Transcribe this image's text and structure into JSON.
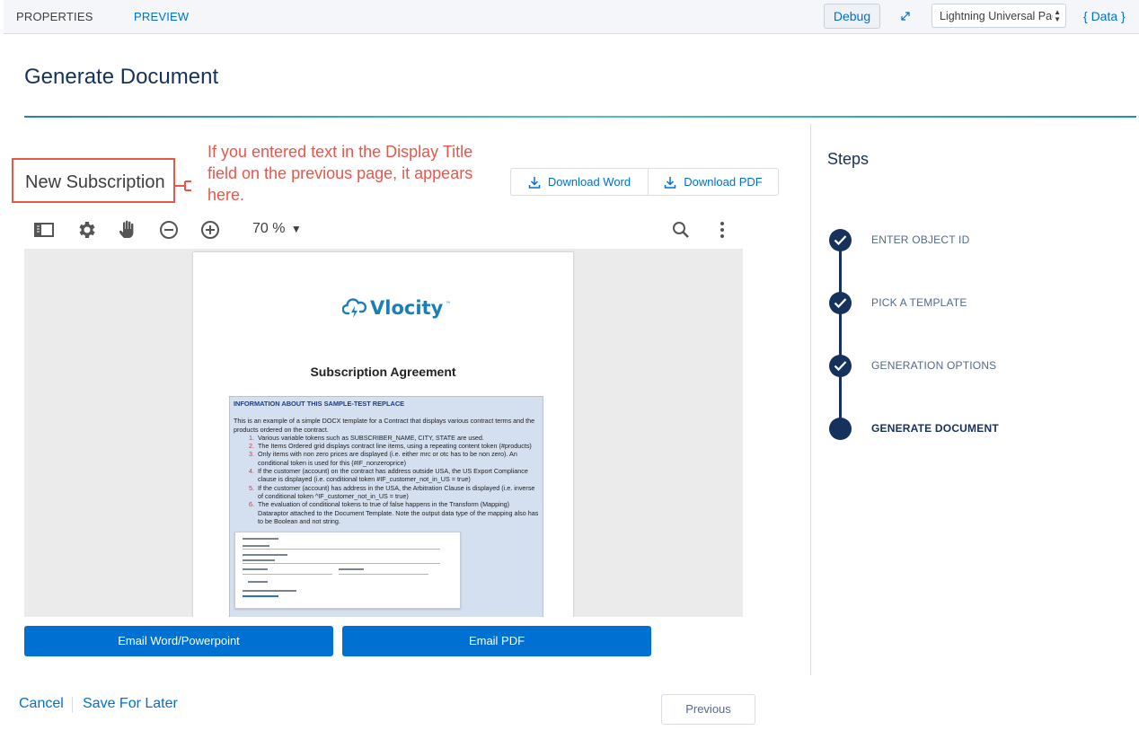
{
  "topbar": {
    "tabs": [
      "PROPERTIES",
      "PREVIEW"
    ],
    "debug_label": "Debug",
    "layout_select": "Lightning Universal Page",
    "data_label": "{ Data }"
  },
  "page": {
    "title": "Generate Document"
  },
  "display_title": "New Subscription",
  "annotation": "If you entered text in the Display Title field on the previous page, it appears here.",
  "downloads": {
    "word": "Download Word",
    "pdf": "Download PDF"
  },
  "viewer": {
    "zoom": "70 %",
    "document": {
      "logo": "Vlocity",
      "heading": "Subscription Agreement",
      "section_head": "INFORMATION ABOUT THIS SAMPLE-TEST REPLACE",
      "intro": "This is an example of a simple DOCX template for a Contract that displays various contract terms and the products ordered on the contract.",
      "items": [
        "Various variable tokens such as SUBSCRIBER_NAME, CITY, STATE are used.",
        "The Items Ordered grid displays contract line items, using a repeating content token (#products)",
        "Only items with non zero prices are displayed (i.e. either mrc or otc has to be non zero). An conditional token is used for this (#IF_nonzeroprice)",
        "If the customer (account) on the contract has address outside USA, the US Export Compliance clause is displayed (i.e. conditional token #IF_customer_not_in_US = true)",
        "If the customer (account) has address in the USA, the Arbitration Clause is displayed (i.e. inverse of conditional token ^IF_customer_not_in_US = true)",
        "The evaluation of conditional tokens to true of false happens in the Transform (Mapping) Dataraptor attached to the Document Template. Note the output data type of the mapping also has to be Boolean and not string."
      ]
    }
  },
  "actions": {
    "email_word": "Email Word/Powerpoint",
    "email_pdf": "Email PDF",
    "cancel": "Cancel",
    "save_later": "Save For Later",
    "previous": "Previous"
  },
  "steps": {
    "title": "Steps",
    "items": [
      {
        "label": "ENTER OBJECT ID",
        "state": "complete"
      },
      {
        "label": "PICK A TEMPLATE",
        "state": "complete"
      },
      {
        "label": "GENERATION OPTIONS",
        "state": "complete"
      },
      {
        "label": "GENERATE DOCUMENT",
        "state": "active"
      }
    ]
  },
  "colors": {
    "brand_blue": "#0070d2",
    "navy": "#16325c",
    "annotation_red": "#e8564a"
  }
}
